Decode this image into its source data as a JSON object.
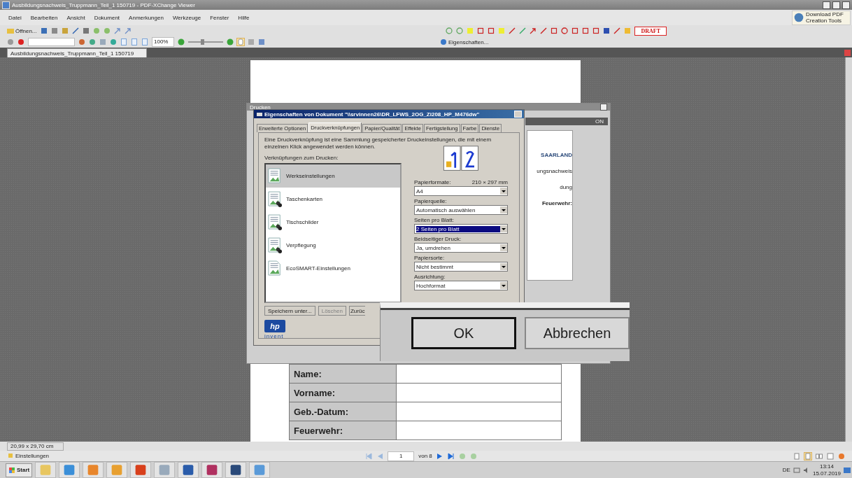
{
  "window": {
    "title": "Ausbildungsnachweis_Truppmann_Teil_1 150719 - PDF-XChange Viewer"
  },
  "menu": [
    "Datei",
    "Bearbeiten",
    "Ansicht",
    "Dokument",
    "Anmerkungen",
    "Werkzeuge",
    "Fenster",
    "Hilfe"
  ],
  "toolbar": {
    "open_label": "Öffnen...",
    "zoom": "100%",
    "zoom_slider": {
      "level": 0.4
    },
    "properties_label": "Eigenschaften...",
    "stamp_label": "DRAFT",
    "promo": "Download PDF Creation Tools"
  },
  "document_tabs": [
    {
      "label": "Ausbildungsnachweis_Truppmann_Teil_1 150719",
      "selected": true
    }
  ],
  "document": {
    "form_rows": [
      {
        "label": "Name:"
      },
      {
        "label": "Vorname:"
      },
      {
        "label": "Geb.-Datum:"
      },
      {
        "label": "Feuerwehr:"
      }
    ]
  },
  "print_dialog": {
    "title": "Drucken",
    "header_text": "ON",
    "preview_texts": [
      "SAARLAND",
      "ungsnachweis",
      "dung",
      "Feuerwehr:"
    ]
  },
  "properties_dialog": {
    "title": "Eigenschaften von Dokument \"\\\\srvinnen26\\DR_LFWS_2OG_Zi208_HP_M476dw\"",
    "tabs": [
      {
        "label": "Erweiterte Optionen",
        "selected": false
      },
      {
        "label": "Druckverknüpfungen",
        "selected": true
      },
      {
        "label": "Papier/Qualität",
        "selected": false
      },
      {
        "label": "Effekte",
        "selected": false
      },
      {
        "label": "Fertigstellung",
        "selected": false
      },
      {
        "label": "Farbe",
        "selected": false
      },
      {
        "label": "Dienste",
        "selected": false
      }
    ],
    "description": "Eine Druckverknüpfung ist eine Sammlung gespeicherter Druckeinstellungen, die mit einem einzelnen Klick angewendet werden können.",
    "list_label": "Verknüpfungen zum Drucken:",
    "shortcuts": [
      {
        "label": "Werkseinstellungen",
        "kind": "settings",
        "selected": true
      },
      {
        "label": "Taschenkarten",
        "kind": "group",
        "selected": false
      },
      {
        "label": "Tischschilder",
        "kind": "group",
        "selected": false
      },
      {
        "label": "Verpflegung",
        "kind": "group",
        "selected": false
      },
      {
        "label": "EcoSMART-Einstellungen",
        "kind": "eco",
        "selected": false
      }
    ],
    "size_note": "210 × 297 mm",
    "options": [
      {
        "label": "Papierformate:",
        "value": "A4",
        "focused": false
      },
      {
        "label": "Papierquelle:",
        "value": "Automatisch auswählen",
        "focused": false
      },
      {
        "label": "Seiten pro Blatt:",
        "value": "2 Seiten pro Blatt",
        "focused": true
      },
      {
        "label": "Beidseitiger Druck:",
        "value": "Ja, umdrehen",
        "focused": false
      },
      {
        "label": "Papiersorte:",
        "value": "Nicht bestimmt",
        "focused": false
      },
      {
        "label": "Ausrichtung:",
        "value": "Hochformat",
        "focused": false
      }
    ],
    "buttons": [
      {
        "label": "Speichern unter...",
        "disabled": false
      },
      {
        "label": "Löschen",
        "disabled": true
      },
      {
        "label": "Zurüc",
        "disabled": false
      }
    ],
    "logo": "hp",
    "logo_tagline": "invent"
  },
  "confirm_overlay": {
    "buttons": [
      "OK",
      "Abbrechen"
    ]
  },
  "status_bar": {
    "page_size": "20,99 x 29,70 cm"
  },
  "bottom_toolbar": {
    "settings_label": "Einstellungen",
    "page": "1",
    "page_count": "von 8"
  },
  "taskbar": {
    "start": "Start",
    "language": "DE",
    "time": "13:14",
    "date": "15.07.2019"
  }
}
